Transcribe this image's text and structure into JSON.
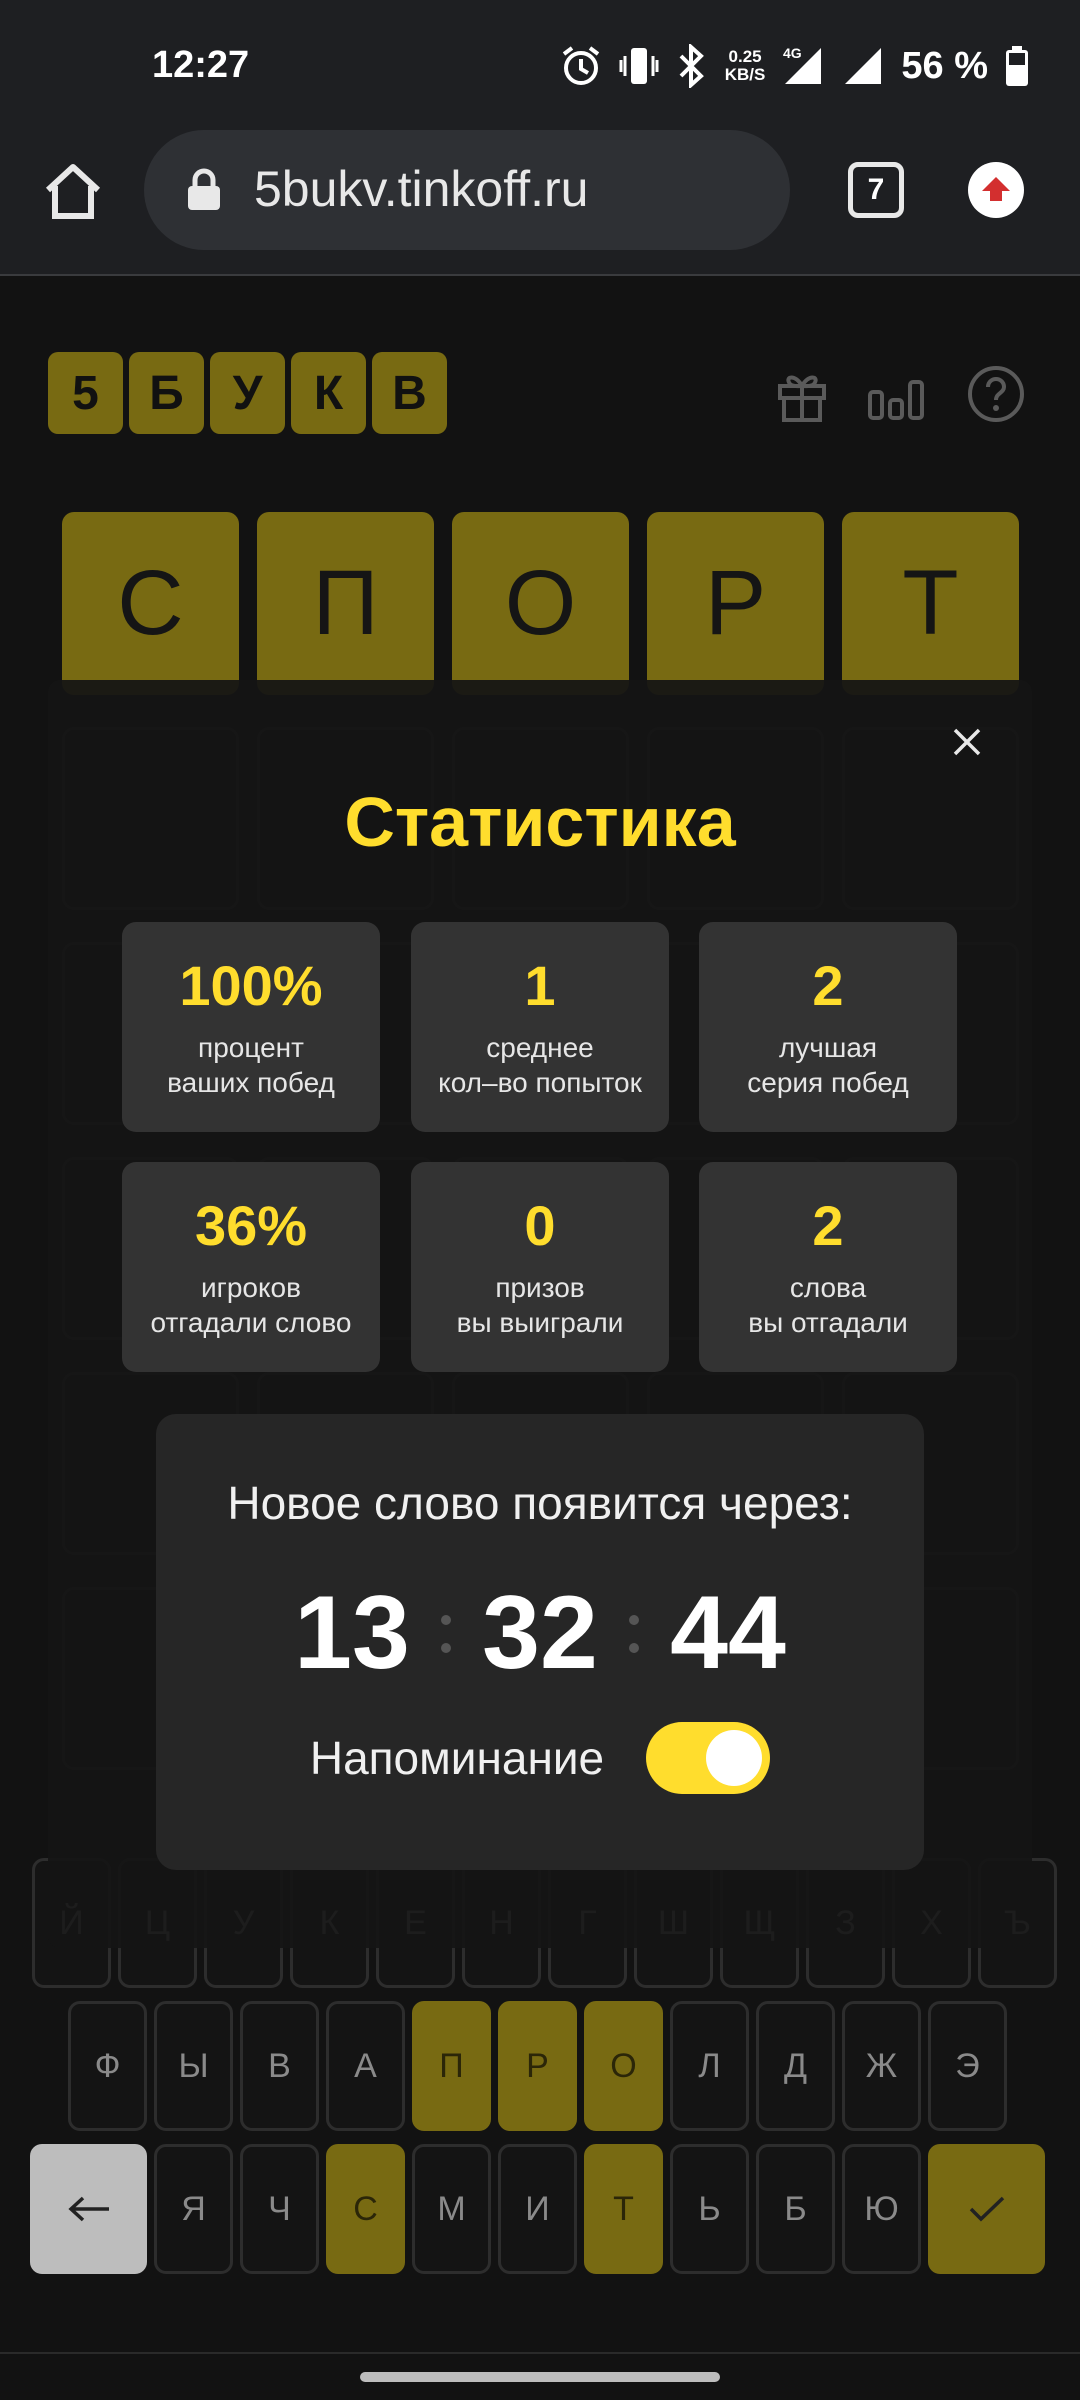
{
  "status_bar": {
    "time": "12:27",
    "net_speed_value": "0.25",
    "net_speed_unit": "KB/S",
    "network_type": "4G",
    "battery_percent": "56 %",
    "icons": [
      "alarm-icon",
      "vibrate-icon",
      "bluetooth-icon",
      "signal-icon",
      "battery-icon"
    ]
  },
  "browser": {
    "url": "5bukv.tinkoff.ru",
    "tab_count": "7"
  },
  "game": {
    "logo_letters": [
      "5",
      "Б",
      "У",
      "К",
      "В"
    ],
    "header_icons": [
      "gift-icon",
      "stats-icon",
      "help-icon"
    ],
    "solved_word": [
      "С",
      "П",
      "О",
      "Р",
      "Т"
    ],
    "empty_rows": 5
  },
  "keyboard": {
    "row1": [
      "Й",
      "Ц",
      "У",
      "К",
      "Е",
      "Н",
      "Г",
      "Ш",
      "Щ",
      "З",
      "Х",
      "Ъ"
    ],
    "row2": [
      "Ф",
      "Ы",
      "В",
      "А",
      "П",
      "Р",
      "О",
      "Л",
      "Д",
      "Ж",
      "Э"
    ],
    "row3": [
      "Я",
      "Ч",
      "С",
      "М",
      "И",
      "Т",
      "Ь",
      "Б",
      "Ю"
    ],
    "highlighted": [
      "П",
      "Р",
      "О",
      "С",
      "Т"
    ],
    "colors": {
      "hit": "#786a12",
      "accent": "#ffdd2d"
    }
  },
  "stats_modal": {
    "title": "Статистика",
    "stats": [
      {
        "value": "100%",
        "label_line1": "процент",
        "label_line2": "ваших побед"
      },
      {
        "value": "1",
        "label_line1": "среднее",
        "label_line2": "кол–во попыток"
      },
      {
        "value": "2",
        "label_line1": "лучшая",
        "label_line2": "серия побед"
      },
      {
        "value": "36%",
        "label_line1": "игроков",
        "label_line2": "отгадали слово"
      },
      {
        "value": "0",
        "label_line1": "призов",
        "label_line2": "вы выиграли"
      },
      {
        "value": "2",
        "label_line1": "слова",
        "label_line2": "вы отгадали"
      }
    ],
    "timer_caption": "Новое слово появится через:",
    "timer": {
      "hours": "13",
      "minutes": "32",
      "seconds": "44"
    },
    "reminder_label": "Напоминание",
    "reminder_on": true
  }
}
